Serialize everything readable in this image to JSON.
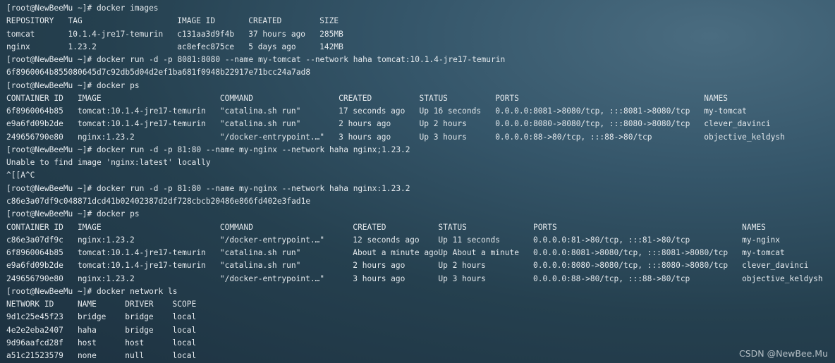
{
  "terminal": {
    "prompt": "[root@NewBeeMu ~]# ",
    "blocks": [
      {
        "command": "docker images",
        "table": {
          "headers": [
            "REPOSITORY",
            "TAG",
            "IMAGE ID",
            "CREATED",
            "SIZE"
          ],
          "rows": [
            [
              "tomcat",
              "10.1.4-jre17-temurin",
              "c131aa3d9f4b",
              "37 hours ago",
              "285MB"
            ],
            [
              "nginx",
              "1.23.2",
              "ac8efec875ce",
              "5 days ago",
              "142MB"
            ]
          ]
        }
      },
      {
        "command": "docker run -d -p 8081:8080 --name my-tomcat --network haha tomcat:10.1.4-jre17-temurin",
        "output": [
          "6f8960064b855080645d7c92db5d04d2ef1ba681f0948b22917e71bcc24a7ad8"
        ]
      },
      {
        "command": "docker ps",
        "table": {
          "headers": [
            "CONTAINER ID",
            "IMAGE",
            "COMMAND",
            "CREATED",
            "STATUS",
            "PORTS",
            "NAMES"
          ],
          "rows": [
            [
              "6f8960064b85",
              "tomcat:10.1.4-jre17-temurin",
              "\"catalina.sh run\"",
              "17 seconds ago",
              "Up 16 seconds",
              "0.0.0.0:8081->8080/tcp, :::8081->8080/tcp",
              "my-tomcat"
            ],
            [
              "e9a6fd09b2de",
              "tomcat:10.1.4-jre17-temurin",
              "\"catalina.sh run\"",
              "2 hours ago",
              "Up 2 hours",
              "0.0.0.0:8080->8080/tcp, :::8080->8080/tcp",
              "clever_davinci"
            ],
            [
              "249656790e80",
              "nginx:1.23.2",
              "\"/docker-entrypoint.…\"",
              "3 hours ago",
              "Up 3 hours",
              "0.0.0.0:88->80/tcp, :::88->80/tcp",
              "objective_keldysh"
            ]
          ]
        }
      },
      {
        "command": "docker run -d -p 81:80 --name my-nginx --network haha nginx;1.23.2",
        "output": [
          "Unable to find image 'nginx:latest' locally",
          "^[[A^C"
        ]
      },
      {
        "command": "docker run -d -p 81:80 --name my-nginx --network haha nginx:1.23.2",
        "output": [
          "c86e3a07df9c048871dcd41b02402387d2df728cbcb20486e866fd402e3fad1e"
        ]
      },
      {
        "command": "docker ps",
        "table": {
          "headers": [
            "CONTAINER ID",
            "IMAGE",
            "COMMAND",
            "CREATED",
            "STATUS",
            "PORTS",
            "NAMES"
          ],
          "rows": [
            [
              "c86e3a07df9c",
              "nginx:1.23.2",
              "\"/docker-entrypoint.…\"",
              "12 seconds ago",
              "Up 11 seconds",
              "0.0.0.0:81->80/tcp, :::81->80/tcp",
              "my-nginx"
            ],
            [
              "6f8960064b85",
              "tomcat:10.1.4-jre17-temurin",
              "\"catalina.sh run\"",
              "About a minute ago",
              "Up About a minute",
              "0.0.0.0:8081->8080/tcp, :::8081->8080/tcp",
              "my-tomcat"
            ],
            [
              "e9a6fd09b2de",
              "tomcat:10.1.4-jre17-temurin",
              "\"catalina.sh run\"",
              "2 hours ago",
              "Up 2 hours",
              "0.0.0.0:8080->8080/tcp, :::8080->8080/tcp",
              "clever_davinci"
            ],
            [
              "249656790e80",
              "nginx:1.23.2",
              "\"/docker-entrypoint.…\"",
              "3 hours ago",
              "Up 3 hours",
              "0.0.0.0:88->80/tcp, :::88->80/tcp",
              "objective_keldysh"
            ]
          ]
        }
      },
      {
        "command": "docker network ls",
        "table": {
          "headers": [
            "NETWORK ID",
            "NAME",
            "DRIVER",
            "SCOPE"
          ],
          "rows": [
            [
              "9d1c25e45f23",
              "bridge",
              "bridge",
              "local"
            ],
            [
              "4e2e2eba2407",
              "haha",
              "bridge",
              "local"
            ],
            [
              "9d96aafcd28f",
              "host",
              "host",
              "local"
            ],
            [
              "a51c21523579",
              "none",
              "null",
              "local"
            ]
          ]
        }
      }
    ]
  },
  "watermark": "CSDN @NewBee.Mu"
}
